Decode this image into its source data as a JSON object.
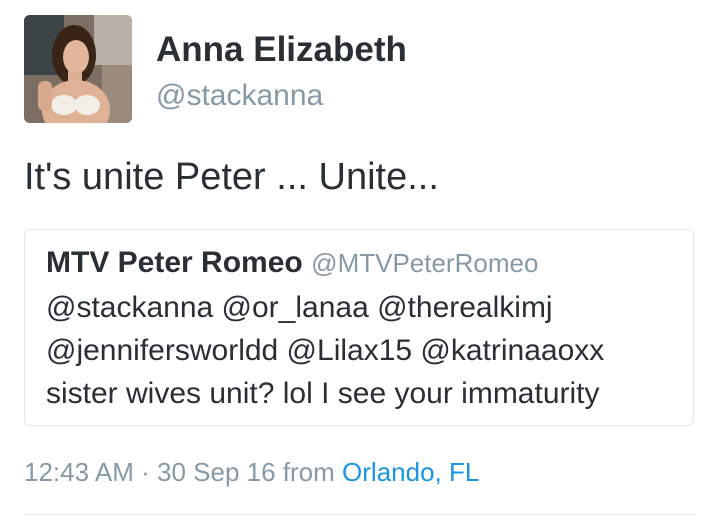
{
  "author": {
    "display_name": "Anna Elizabeth",
    "handle": "@stackanna"
  },
  "tweet": {
    "text": "It's unite Peter ... Unite..."
  },
  "quoted_tweet": {
    "display_name": "MTV Peter Romeo",
    "handle": "@MTVPeterRomeo",
    "lines": [
      "@stackanna @or_lanaa @therealkimj",
      "@jennifersworldd @Lilax15 @katrinaaoxx",
      "sister wives unit? lol I see your immaturity"
    ]
  },
  "meta": {
    "time": "12:43 AM",
    "separator": "·",
    "date": "30 Sep 16",
    "from_label": "from",
    "location": "Orlando, FL"
  },
  "colors": {
    "text": "#292f33",
    "secondary": "#8899a6",
    "link": "#1b95e0",
    "border": "#e1e8ed"
  }
}
